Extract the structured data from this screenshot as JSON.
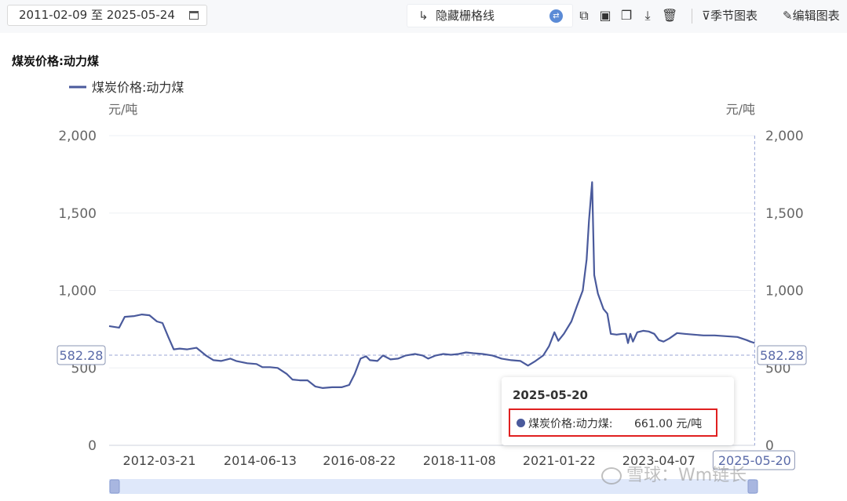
{
  "toolbar": {
    "date_range": "2011-02-09 至 2025-05-24",
    "grid_toggle_label": "隐藏栅格线",
    "seasonal_label": "季节图表",
    "edit_label": "编辑图表"
  },
  "watermark": "雪球：Wm链长",
  "colors": {
    "line": "#4a5a9c",
    "grid": "#eef0f4",
    "marker": "#99a6d6",
    "highlight": "#e02020"
  },
  "tooltip": {
    "date": "2025-05-20",
    "series": "煤炭价格:动力煤:",
    "value": "661.00 元/吨"
  },
  "chart_data": {
    "type": "line",
    "title": "煤炭价格:动力煤",
    "legend": [
      "煤炭价格:动力煤"
    ],
    "unit_left": "元/吨",
    "unit_right": "元/吨",
    "ylim": [
      0,
      2000
    ],
    "y_ticks": [
      "0",
      "500",
      "1,000",
      "1,500",
      "2,000"
    ],
    "x_tick_labels": [
      "2012-03-21",
      "2014-06-13",
      "2016-08-22",
      "2018-11-08",
      "2021-01-22",
      "2023-04-07",
      "2025-05-20"
    ],
    "marker_line": {
      "value": 582.28,
      "label": "582.28"
    },
    "series": [
      {
        "name": "煤炭价格:动力煤",
        "points": [
          [
            "2011-02-09",
            770
          ],
          [
            "2011-05-01",
            760
          ],
          [
            "2011-06-15",
            830
          ],
          [
            "2011-09-01",
            835
          ],
          [
            "2011-11-01",
            845
          ],
          [
            "2012-01-01",
            840
          ],
          [
            "2012-03-01",
            800
          ],
          [
            "2012-04-15",
            790
          ],
          [
            "2012-06-01",
            700
          ],
          [
            "2012-07-15",
            620
          ],
          [
            "2012-09-01",
            625
          ],
          [
            "2012-11-01",
            620
          ],
          [
            "2013-01-15",
            630
          ],
          [
            "2013-04-01",
            580
          ],
          [
            "2013-06-01",
            550
          ],
          [
            "2013-08-01",
            545
          ],
          [
            "2013-10-15",
            560
          ],
          [
            "2013-12-01",
            545
          ],
          [
            "2014-03-01",
            530
          ],
          [
            "2014-05-15",
            525
          ],
          [
            "2014-07-01",
            505
          ],
          [
            "2014-09-01",
            505
          ],
          [
            "2014-11-01",
            500
          ],
          [
            "2015-01-15",
            460
          ],
          [
            "2015-03-01",
            425
          ],
          [
            "2015-05-01",
            420
          ],
          [
            "2015-07-01",
            420
          ],
          [
            "2015-09-01",
            380
          ],
          [
            "2015-11-01",
            370
          ],
          [
            "2016-01-15",
            375
          ],
          [
            "2016-04-01",
            375
          ],
          [
            "2016-06-01",
            390
          ],
          [
            "2016-07-15",
            460
          ],
          [
            "2016-09-01",
            560
          ],
          [
            "2016-10-15",
            575
          ],
          [
            "2016-11-15",
            550
          ],
          [
            "2017-01-15",
            545
          ],
          [
            "2017-03-01",
            580
          ],
          [
            "2017-05-01",
            555
          ],
          [
            "2017-07-01",
            560
          ],
          [
            "2017-09-01",
            580
          ],
          [
            "2017-11-15",
            590
          ],
          [
            "2018-01-15",
            580
          ],
          [
            "2018-03-01",
            560
          ],
          [
            "2018-05-01",
            580
          ],
          [
            "2018-07-01",
            590
          ],
          [
            "2018-09-01",
            585
          ],
          [
            "2018-11-01",
            590
          ],
          [
            "2019-01-01",
            600
          ],
          [
            "2019-03-01",
            595
          ],
          [
            "2019-05-15",
            590
          ],
          [
            "2019-08-01",
            580
          ],
          [
            "2019-10-15",
            560
          ],
          [
            "2020-01-01",
            550
          ],
          [
            "2020-03-15",
            545
          ],
          [
            "2020-05-15",
            515
          ],
          [
            "2020-07-15",
            545
          ],
          [
            "2020-09-15",
            580
          ],
          [
            "2020-11-01",
            640
          ],
          [
            "2020-12-15",
            730
          ],
          [
            "2021-01-15",
            675
          ],
          [
            "2021-03-01",
            720
          ],
          [
            "2021-05-01",
            800
          ],
          [
            "2021-06-15",
            900
          ],
          [
            "2021-08-01",
            1000
          ],
          [
            "2021-09-01",
            1200
          ],
          [
            "2021-09-20",
            1450
          ],
          [
            "2021-10-15",
            1700
          ],
          [
            "2021-11-01",
            1100
          ],
          [
            "2021-12-01",
            980
          ],
          [
            "2022-01-15",
            880
          ],
          [
            "2022-02-15",
            850
          ],
          [
            "2022-03-15",
            720
          ],
          [
            "2022-05-01",
            715
          ],
          [
            "2022-06-15",
            720
          ],
          [
            "2022-07-15",
            720
          ],
          [
            "2022-08-01",
            660
          ],
          [
            "2022-08-20",
            720
          ],
          [
            "2022-09-10",
            670
          ],
          [
            "2022-10-15",
            730
          ],
          [
            "2022-12-01",
            740
          ],
          [
            "2023-01-15",
            735
          ],
          [
            "2023-03-01",
            720
          ],
          [
            "2023-04-07",
            680
          ],
          [
            "2023-05-15",
            670
          ],
          [
            "2023-07-01",
            690
          ],
          [
            "2023-09-01",
            725
          ],
          [
            "2023-11-01",
            720
          ],
          [
            "2024-01-15",
            715
          ],
          [
            "2024-04-01",
            710
          ],
          [
            "2024-07-01",
            710
          ],
          [
            "2024-10-01",
            705
          ],
          [
            "2025-01-01",
            700
          ],
          [
            "2025-03-15",
            680
          ],
          [
            "2025-04-15",
            670
          ],
          [
            "2025-05-20",
            661
          ]
        ]
      }
    ]
  }
}
